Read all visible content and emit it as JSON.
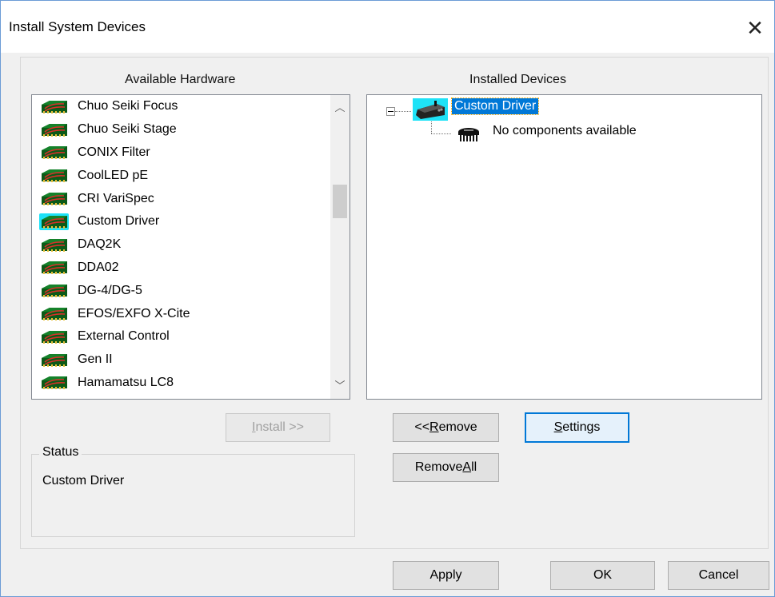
{
  "window": {
    "title": "Install System Devices",
    "close_glyph": "✕"
  },
  "available_hardware": {
    "heading": "Available Hardware",
    "items": [
      {
        "label": "Chuo Seiki Focus",
        "icon": "hardware-card-icon"
      },
      {
        "label": "Chuo Seiki Stage",
        "icon": "hardware-card-icon"
      },
      {
        "label": "CONIX Filter",
        "icon": "hardware-card-icon"
      },
      {
        "label": "CoolLED pE",
        "icon": "hardware-card-icon"
      },
      {
        "label": "CRI VariSpec",
        "icon": "hardware-card-icon"
      },
      {
        "label": "Custom Driver",
        "icon": "hardware-card-icon",
        "selected": true
      },
      {
        "label": "DAQ2K",
        "icon": "hardware-card-icon"
      },
      {
        "label": "DDA02",
        "icon": "hardware-card-icon"
      },
      {
        "label": "DG-4/DG-5",
        "icon": "hardware-card-icon"
      },
      {
        "label": "EFOS/EXFO X-Cite",
        "icon": "hardware-card-icon"
      },
      {
        "label": "External Control",
        "icon": "hardware-card-icon"
      },
      {
        "label": "Gen II",
        "icon": "hardware-card-icon"
      },
      {
        "label": "Hamamatsu LC8",
        "icon": "hardware-card-icon"
      }
    ],
    "scroll_up_glyph": "︿",
    "scroll_down_glyph": "﹀"
  },
  "installed_devices": {
    "heading": "Installed Devices",
    "tree": {
      "expander": "minus",
      "node_label": "Custom Driver",
      "child_label": "No components available"
    }
  },
  "buttons": {
    "install": {
      "pre": "",
      "key": "I",
      "post": "nstall >>",
      "enabled": false
    },
    "remove": {
      "pre": "<< ",
      "key": "R",
      "post": "emove"
    },
    "settings": {
      "pre": "",
      "key": "S",
      "post": "ettings"
    },
    "remove_all": {
      "pre": "Remove ",
      "key": "A",
      "post": "ll"
    },
    "apply": "Apply",
    "ok": "OK",
    "cancel": "Cancel"
  },
  "status": {
    "legend": "Status",
    "text": "Custom Driver"
  },
  "colors": {
    "selection_blue": "#0078d7",
    "icon_highlight_cyan": "#1ee2f7",
    "dialog_background": "#f0f0f0",
    "title_bar_white": "#ffffff"
  }
}
